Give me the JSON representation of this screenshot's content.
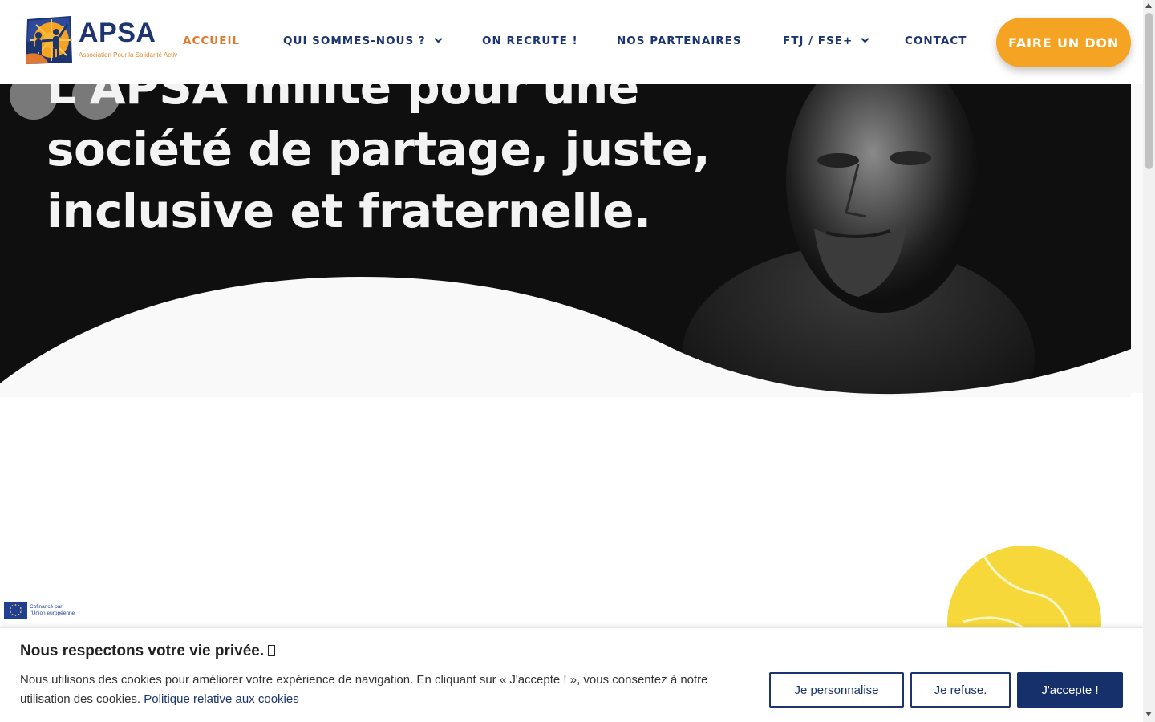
{
  "header": {
    "logo_name": "APSA",
    "logo_tagline": "Association Pour la Solidarité Activ",
    "nav": [
      {
        "label": "ACCUEIL",
        "active": true,
        "dropdown": false
      },
      {
        "label": "QUI SOMMES-NOUS ?",
        "active": false,
        "dropdown": true
      },
      {
        "label": "ON RECRUTE !",
        "active": false,
        "dropdown": false
      },
      {
        "label": "NOS PARTENAIRES",
        "active": false,
        "dropdown": false
      },
      {
        "label": "FTJ / FSE+",
        "active": false,
        "dropdown": true
      },
      {
        "label": "CONTACT",
        "active": false,
        "dropdown": false
      }
    ],
    "donate_label": "FAIRE UN DON"
  },
  "hero": {
    "lines": [
      "L'APSA milite pour une",
      "société de partage, juste,",
      "inclusive et fraternelle."
    ]
  },
  "eu_badge": {
    "line1": "Cofinancé par",
    "line2": "l'Union européenne"
  },
  "cookie": {
    "title": "Nous respectons votre vie privée. ",
    "title_icon": "cookie-icon",
    "text": "Nous utilisons des cookies pour améliorer votre expérience de navigation. En cliquant sur « J'accepte ! », vous consentez à notre utilisation des cookies.",
    "link": "Politique relative aux cookies",
    "buttons": {
      "customize": "Je personnalise",
      "refuse": "Je refuse.",
      "accept": "J'accepte !"
    }
  },
  "colors": {
    "navy": "#1c3570",
    "orange": "#e2792e",
    "donate": "#f5a323",
    "ball": "#f6d83a",
    "hero_bg": "#0f0f10"
  }
}
